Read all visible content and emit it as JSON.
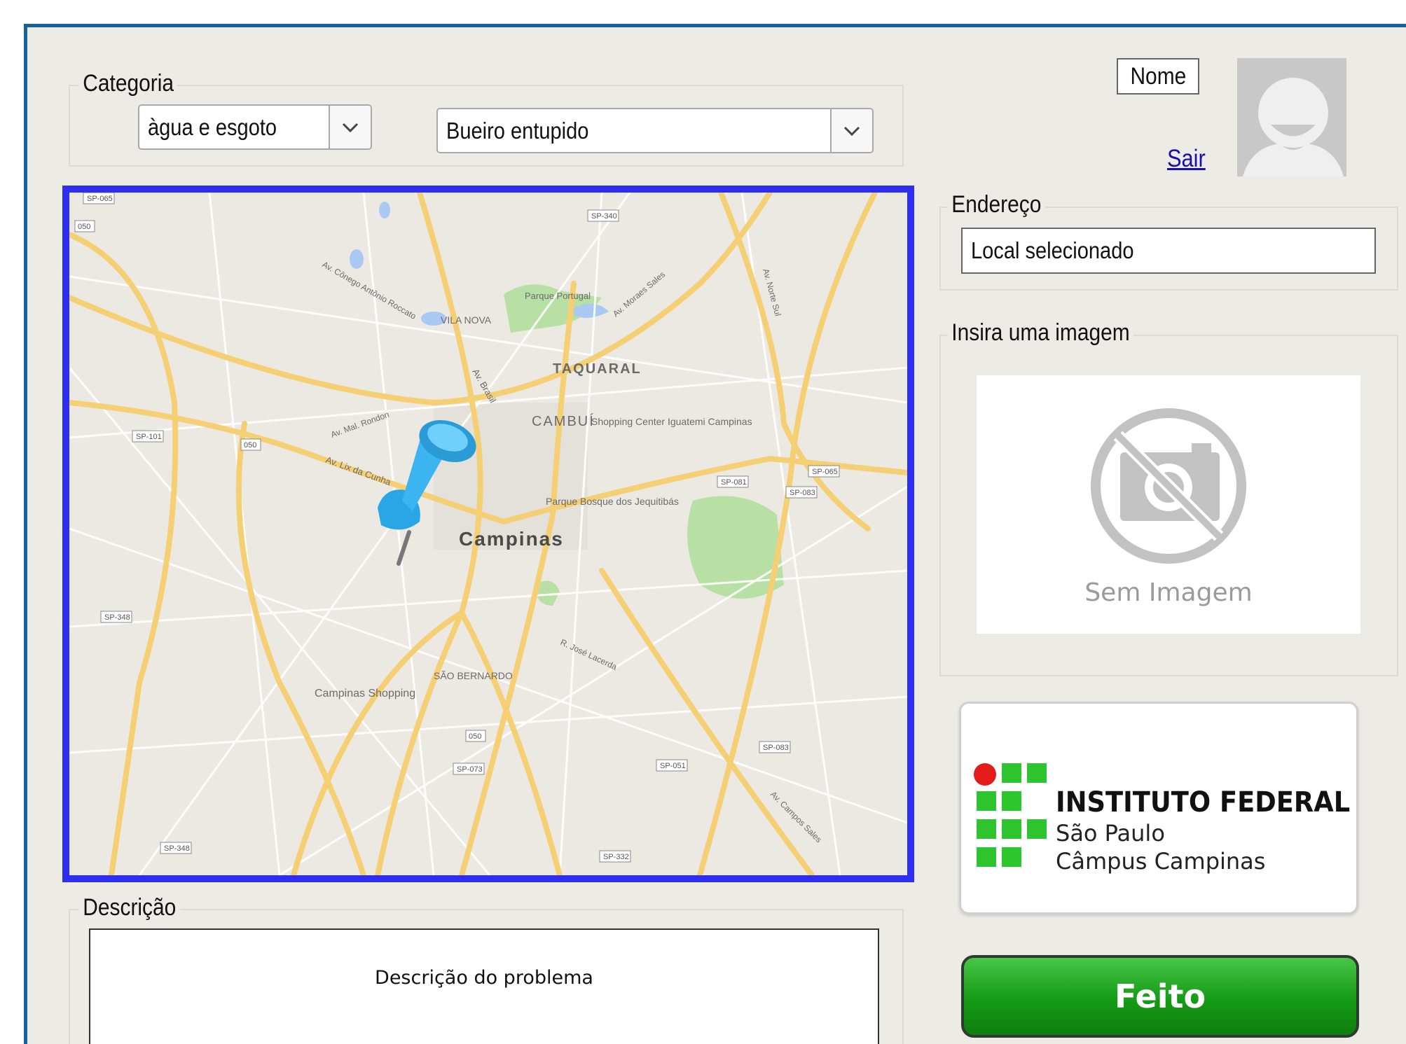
{
  "category": {
    "legend": "Categoria",
    "type_select": "àgua e esgoto",
    "problem_select": "Bueiro entupido"
  },
  "user": {
    "name_label": "Nome",
    "logout_link": "Sair"
  },
  "address": {
    "legend": "Endereço",
    "value": "Local selecionado"
  },
  "image": {
    "legend": "Insira uma imagem",
    "placeholder_text": "Sem Imagem"
  },
  "map": {
    "city_label": "Campinas",
    "district_labels": [
      "TAQUARAL",
      "CAMBUÍ",
      "VILA NOVA",
      "SÃO BERNARDO"
    ],
    "poi_labels": [
      "Parque Portugal",
      "Shopping Center Iguatemi Campinas",
      "Parque Bosque dos Jequitibás",
      "Campinas Shopping"
    ],
    "road_labels": [
      "Av. Brasil",
      "Av. Lix da Cunha",
      "Av. Mal. Rondon",
      "Av. Cônego Antônio Roccato",
      "R. José Lacerda",
      "Av. Moraes Sales",
      "Av. Norte Sul",
      "Av. Campos Sales"
    ],
    "highway_labels": [
      "SP-065",
      "SP-340",
      "SP-101",
      "050",
      "SP-081",
      "SP-065",
      "SP-083",
      "SP-348",
      "050",
      "SP-073",
      "SP-051",
      "SP-083",
      "SP-348",
      "SP-332",
      "050"
    ]
  },
  "logo": {
    "line1": "INSTITUTO FEDERAL",
    "line2": "São Paulo",
    "line3": "Câmpus Campinas",
    "colors": {
      "green": "#2ec52e",
      "red": "#e31b1b"
    }
  },
  "description": {
    "legend": "Descrição",
    "placeholder": "Descrição do problema"
  },
  "submit_button": "Feito",
  "colors": {
    "map_border": "#2e2ef2",
    "window_border": "#17629b",
    "panel_bg": "#edebe6",
    "link": "#1a0dab",
    "button_green": "#159b15"
  }
}
